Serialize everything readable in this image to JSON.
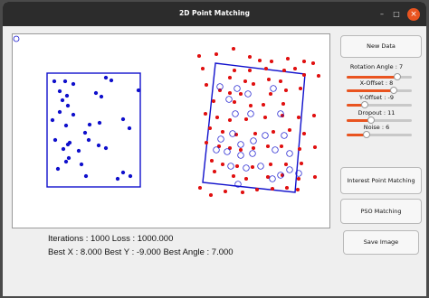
{
  "window": {
    "title": "2D Point Matching",
    "minimize_glyph": "–",
    "maximize_glyph": "□",
    "close_glyph": "×"
  },
  "buttons": {
    "new_data": "New Data",
    "interest_point_matching": "Interest Point Matching",
    "pso_matching": "PSO Matching",
    "save_image": "Save Image"
  },
  "sliders": [
    {
      "label": "Rotation Angle : 7",
      "fraction": 0.78
    },
    {
      "label": "X-Offset : 8",
      "fraction": 0.72
    },
    {
      "label": "Y-Offset : -9",
      "fraction": 0.28
    },
    {
      "label": "Dropout : 11",
      "fraction": 0.38
    },
    {
      "label": "Noise : 6",
      "fraction": 0.3
    }
  ],
  "info": {
    "line1": "Iterations : 1000  Loss : 1000.000",
    "line2": "Best X : 8.000  Best Y : -9.000  Best Angle : 7.000"
  },
  "colors": {
    "model": "#1010cc",
    "target": "#e01010",
    "accent": "#e95420"
  }
}
